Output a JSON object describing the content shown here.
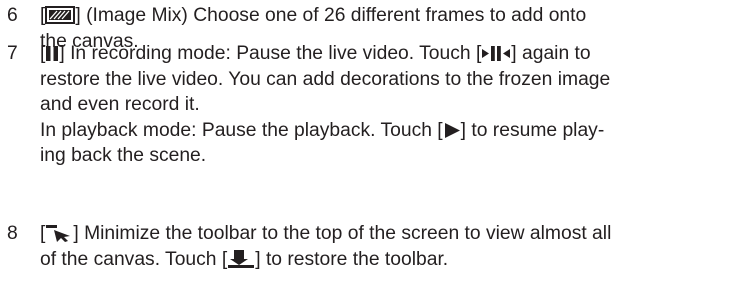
{
  "items": [
    {
      "number": "6",
      "lines": [
        {
          "pre": "[",
          "icon": "image-mix-icon",
          "post": "] (Image Mix) Choose one of 26 different frames to add onto"
        },
        {
          "text": "the canvas."
        }
      ]
    },
    {
      "number": "7",
      "lines": [
        {
          "pre": "[",
          "icon": "pause-icon",
          "post": "] In recording mode: Pause the live video. Touch [",
          "icon2": "play-pause-icon",
          "post2": "] again to"
        },
        {
          "text": "restore the live video. You can add decorations to the frozen image"
        },
        {
          "text": "and even record it."
        },
        {
          "text": "In playback mode: Pause the playback. Touch [",
          "icon": "play-icon",
          "post": "] to resume play-"
        },
        {
          "text": "ing back the scene."
        }
      ]
    },
    {
      "number": "8",
      "lines": [
        {
          "pre": "[",
          "icon": "minimize-toolbar-icon",
          "post": "] Minimize the toolbar to the top of the screen to view almost all"
        },
        {
          "text": "of the canvas. Touch [",
          "icon": "restore-toolbar-icon",
          "post": "] to restore the toolbar."
        }
      ]
    }
  ]
}
